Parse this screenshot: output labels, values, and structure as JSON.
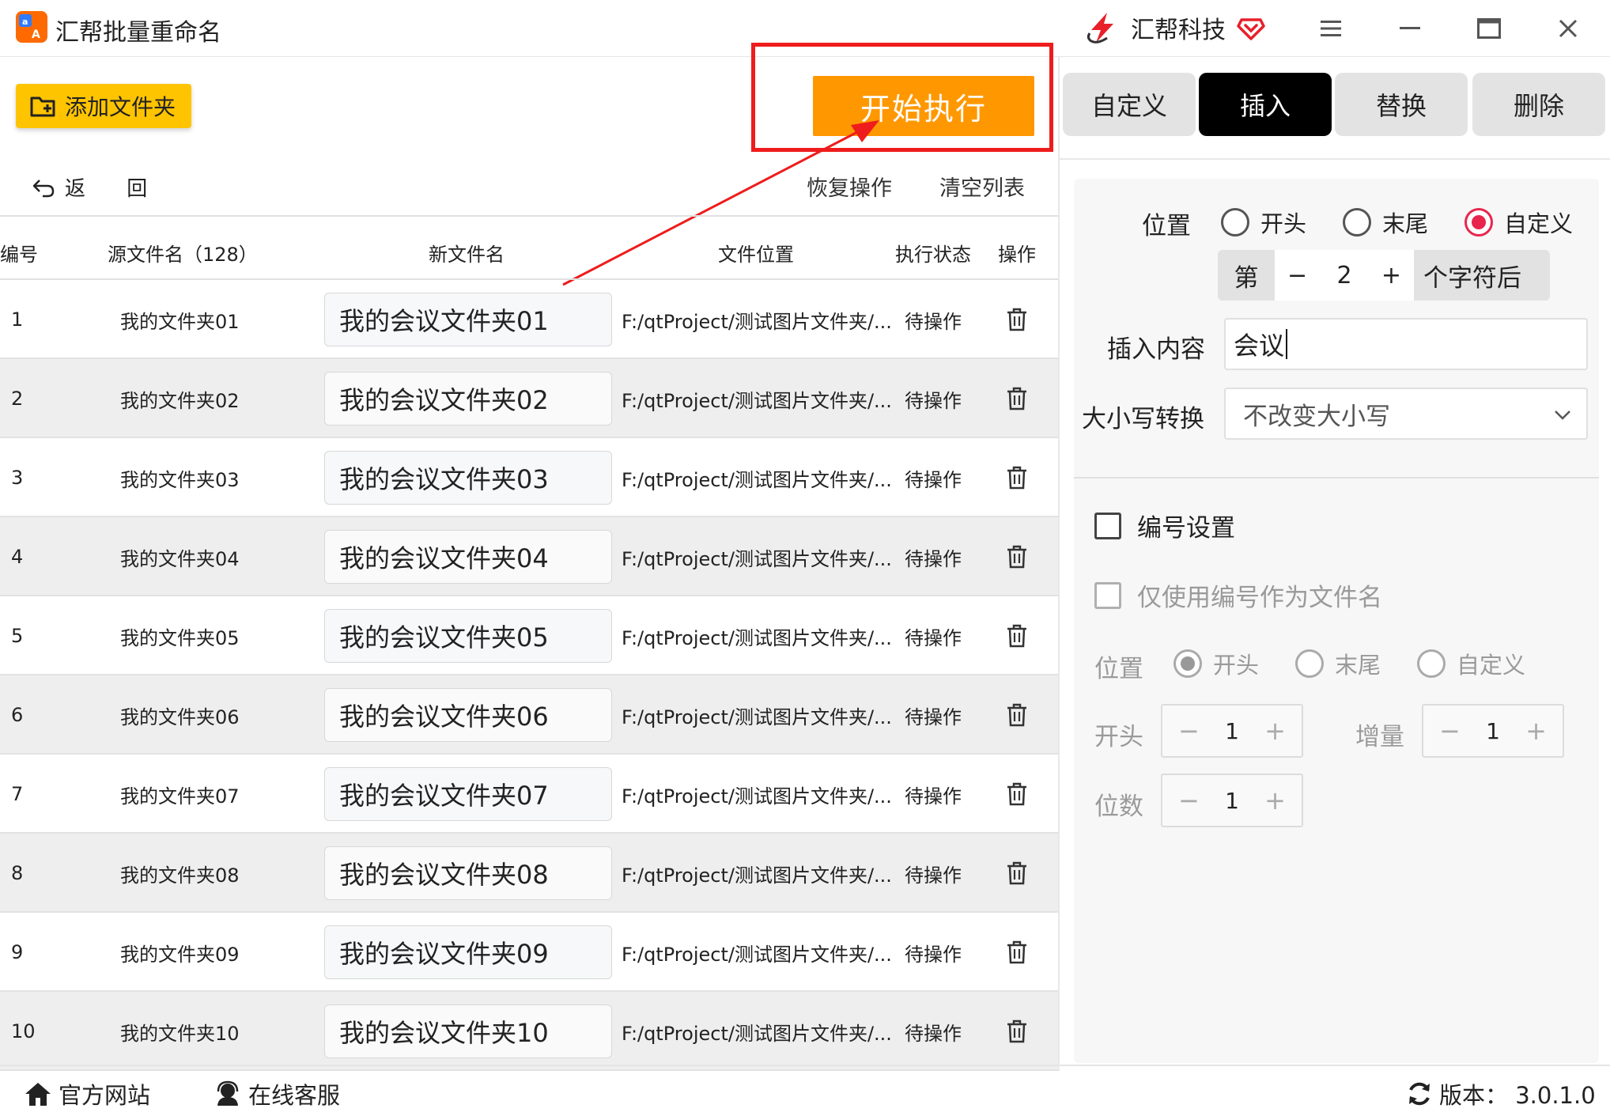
{
  "app": {
    "title": "汇帮批量重命名",
    "brand": "汇帮科技",
    "logo_icon": "app-logo-icon"
  },
  "toolbar": {
    "add_folder": "添加文件夹",
    "start": "开始执行",
    "back": "返 回",
    "restore": "恢复操作",
    "clear": "清空列表"
  },
  "table": {
    "headers": {
      "num": "编号",
      "src": "源文件名（128）",
      "new": "新文件名",
      "path": "文件位置",
      "status": "执行状态",
      "op": "操作"
    },
    "rows": [
      {
        "num": "1",
        "src": "我的文件夹01",
        "new": "我的会议文件夹01",
        "path": "F:/qtProject/测试图片文件夹/...",
        "status": "待操作"
      },
      {
        "num": "2",
        "src": "我的文件夹02",
        "new": "我的会议文件夹02",
        "path": "F:/qtProject/测试图片文件夹/...",
        "status": "待操作"
      },
      {
        "num": "3",
        "src": "我的文件夹03",
        "new": "我的会议文件夹03",
        "path": "F:/qtProject/测试图片文件夹/...",
        "status": "待操作"
      },
      {
        "num": "4",
        "src": "我的文件夹04",
        "new": "我的会议文件夹04",
        "path": "F:/qtProject/测试图片文件夹/...",
        "status": "待操作"
      },
      {
        "num": "5",
        "src": "我的文件夹05",
        "new": "我的会议文件夹05",
        "path": "F:/qtProject/测试图片文件夹/...",
        "status": "待操作"
      },
      {
        "num": "6",
        "src": "我的文件夹06",
        "new": "我的会议文件夹06",
        "path": "F:/qtProject/测试图片文件夹/...",
        "status": "待操作"
      },
      {
        "num": "7",
        "src": "我的文件夹07",
        "new": "我的会议文件夹07",
        "path": "F:/qtProject/测试图片文件夹/...",
        "status": "待操作"
      },
      {
        "num": "8",
        "src": "我的文件夹08",
        "new": "我的会议文件夹08",
        "path": "F:/qtProject/测试图片文件夹/...",
        "status": "待操作"
      },
      {
        "num": "9",
        "src": "我的文件夹09",
        "new": "我的会议文件夹09",
        "path": "F:/qtProject/测试图片文件夹/...",
        "status": "待操作"
      },
      {
        "num": "10",
        "src": "我的文件夹10",
        "new": "我的会议文件夹10",
        "path": "F:/qtProject/测试图片文件夹/...",
        "status": "待操作"
      }
    ]
  },
  "tabs": [
    {
      "label": "自定义",
      "active": false
    },
    {
      "label": "插入",
      "active": true
    },
    {
      "label": "替换",
      "active": false
    },
    {
      "label": "删除",
      "active": false
    }
  ],
  "insert": {
    "position_label": "位置",
    "options": {
      "start": "开头",
      "end": "末尾",
      "custom": "自定义"
    },
    "selected": "custom",
    "stepper": {
      "prefix": "第",
      "value": "2",
      "suffix": "个字符后"
    },
    "content_label": "插入内容",
    "content_value": "会议",
    "case_label": "大小写转换",
    "case_value": "不改变大小写"
  },
  "numbering": {
    "enable_label": "编号设置",
    "only_number_label": "仅使用编号作为文件名",
    "position_label": "位置",
    "options": {
      "start": "开头",
      "end": "末尾",
      "custom": "自定义"
    },
    "selected": "start",
    "start_label": "开头",
    "start_value": "1",
    "increment_label": "增量",
    "increment_value": "1",
    "digits_label": "位数",
    "digits_value": "1"
  },
  "footer": {
    "website": "官方网站",
    "support": "在线客服",
    "version": "版本：  3.0.1.0"
  },
  "colors": {
    "accent": "#ff9800",
    "add_btn": "#ffc400",
    "radio_on": "#e8264d",
    "highlight": "#ee1c1c"
  }
}
